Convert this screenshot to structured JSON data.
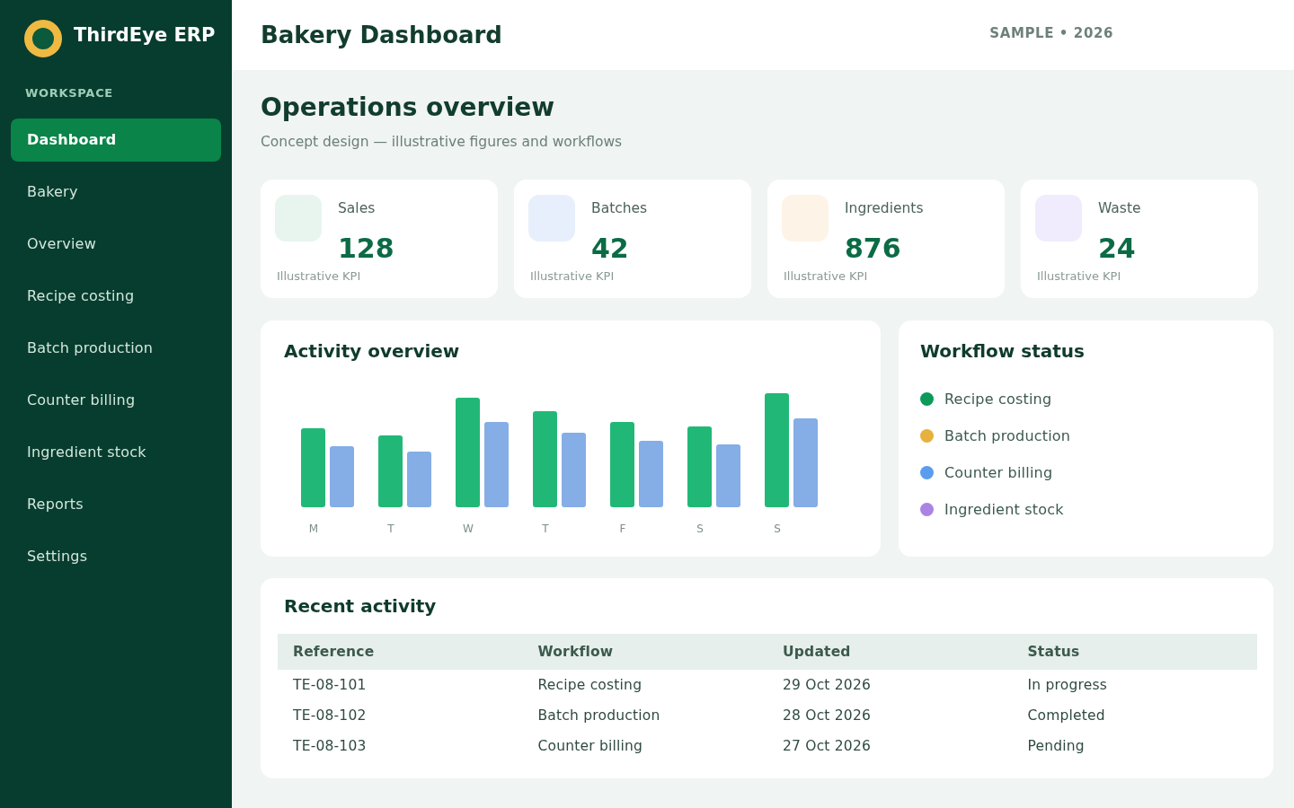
{
  "sidebar": {
    "brand": "ThirdEye ERP",
    "section_label": "WORKSPACE",
    "items": [
      {
        "label": "Dashboard",
        "selected": true
      },
      {
        "label": "Bakery",
        "selected": false
      },
      {
        "label": "Overview",
        "selected": false
      },
      {
        "label": "Recipe costing",
        "selected": false
      },
      {
        "label": "Batch production",
        "selected": false
      },
      {
        "label": "Counter billing",
        "selected": false
      },
      {
        "label": "Ingredient stock",
        "selected": false
      },
      {
        "label": "Reports",
        "selected": false
      },
      {
        "label": "Settings",
        "selected": false
      }
    ]
  },
  "header": {
    "title": "Bakery Dashboard",
    "tag": "SAMPLE • 2026"
  },
  "page": {
    "title": "Operations overview",
    "subtitle": "Concept design — illustrative figures and workflows"
  },
  "kpis": [
    {
      "label": "Sales",
      "value": "128",
      "note": "Illustrative KPI",
      "color": "#e7f5ee"
    },
    {
      "label": "Batches",
      "value": "42",
      "note": "Illustrative KPI",
      "color": "#e8effc"
    },
    {
      "label": "Ingredients",
      "value": "876",
      "note": "Illustrative KPI",
      "color": "#fef3e7"
    },
    {
      "label": "Waste",
      "value": "24",
      "note": "Illustrative KPI",
      "color": "#f0ebfd"
    }
  ],
  "activity": {
    "title": "Activity overview",
    "days": [
      "M",
      "T",
      "W",
      "T",
      "F",
      "S",
      "S"
    ]
  },
  "workflow": {
    "title": "Workflow status",
    "items": [
      {
        "label": "Recipe costing",
        "color": "#0b9a5a"
      },
      {
        "label": "Batch production",
        "color": "#e6b13c"
      },
      {
        "label": "Counter billing",
        "color": "#5b9ded"
      },
      {
        "label": "Ingredient stock",
        "color": "#ab84e3"
      }
    ]
  },
  "recent": {
    "title": "Recent activity",
    "columns": [
      "Reference",
      "Workflow",
      "Updated",
      "Status"
    ],
    "rows": [
      [
        "TE-08-101",
        "Recipe costing",
        "29 Oct 2026",
        "In progress"
      ],
      [
        "TE-08-102",
        "Batch production",
        "28 Oct 2026",
        "Completed"
      ],
      [
        "TE-08-103",
        "Counter billing",
        "27 Oct 2026",
        "Pending"
      ]
    ]
  }
}
